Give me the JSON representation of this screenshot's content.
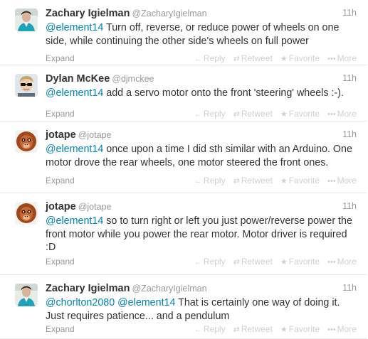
{
  "tweets": [
    {
      "name": "Zachary Igielman",
      "handle": "@ZacharyIgielman",
      "time": "11h",
      "avatar": "avatar-person-blue",
      "lines": [
        [
          {
            "t": "@element14",
            "m": true
          },
          {
            "t": " Turn off, reverse, or reduce power of wheels on one",
            "m": false
          }
        ],
        [
          {
            "t": "side, while continuing the other side's wheels on full power",
            "m": false
          }
        ]
      ]
    },
    {
      "name": "Dylan McKee",
      "handle": "@djmckee",
      "time": "11h",
      "avatar": "avatar-person-sunglasses",
      "lines": [
        [
          {
            "t": "@element14",
            "m": true
          },
          {
            "t": " add a servo motor onto the front 'steering' wheels :-).",
            "m": false
          }
        ]
      ]
    },
    {
      "name": "jotape",
      "handle": "@jotape",
      "time": "11h",
      "avatar": "avatar-orangutan",
      "lines": [
        [
          {
            "t": "@element14",
            "m": true
          },
          {
            "t": " once upon a time I did sth similar with an Arduino. One",
            "m": false
          }
        ],
        [
          {
            "t": "motor drove the rear wheels, one motor steered the front ones.",
            "m": false
          }
        ]
      ]
    },
    {
      "name": "jotape",
      "handle": "@jotape",
      "time": "11h",
      "avatar": "avatar-orangutan",
      "lines": [
        [
          {
            "t": "@element14",
            "m": true
          },
          {
            "t": " so to turn right or left you just power/reverse power the",
            "m": false
          }
        ],
        [
          {
            "t": "front motor while you power the rear motor. Motor driver is required",
            "m": false
          }
        ],
        [
          {
            "t": ":D",
            "m": false
          }
        ]
      ]
    },
    {
      "name": "Zachary Igielman",
      "handle": "@ZacharyIgielman",
      "time": "11h",
      "avatar": "avatar-person-blue",
      "lines": [
        [
          {
            "t": "@chorlton2080",
            "m": true
          },
          {
            "t": " ",
            "m": false
          },
          {
            "t": "@element14",
            "m": true
          },
          {
            "t": " That is certainly one way of doing it.",
            "m": false
          }
        ],
        [
          {
            "t": "Just requires patience... and a pendulum",
            "m": false
          }
        ]
      ]
    }
  ],
  "labels": {
    "expand": "Expand",
    "reply": "Reply",
    "retweet": "Retweet",
    "favorite": "Favorite",
    "more": "More",
    "reply_icon": "reply-icon",
    "retweet_icon": "retweet-icon",
    "favorite_icon": "star-icon",
    "more_icon": "more-dots-icon"
  },
  "colors": {
    "mention": "#0084b4",
    "muted": "#999999",
    "action": "#d0d0d0"
  }
}
